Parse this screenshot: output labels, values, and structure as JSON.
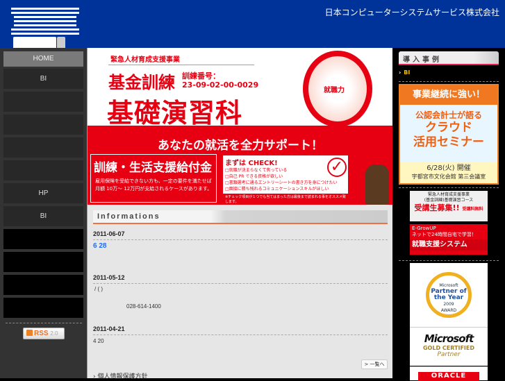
{
  "header": {
    "company": "日本コンピューターシステムサービス株式会社"
  },
  "sidebar": {
    "items": [
      "HOME",
      "BI",
      "",
      "",
      "",
      "",
      "HP",
      "BI",
      "",
      "",
      "",
      ""
    ],
    "rss": {
      "label": "RSS",
      "version": "2.0"
    }
  },
  "banner": {
    "sub": "緊急人材育成支援事業",
    "title1": "基金訓練",
    "number_label": "訓練番号：",
    "number": "23-09-02-00-0029",
    "title2": "基礎演習科",
    "skill": "就職力",
    "slogan": "あなたの就活を全力サポート！",
    "box1_title": "訓練・生活支援給付金",
    "box1_desc1": "雇用保険を受給できない方も、一定の要件を満たせば",
    "box1_desc2": "月額 10万～ 12万円が支給されるケースがあります。",
    "check_title": "まずは CHECK!",
    "check_items": [
      "□就職が決まらなくて焦っている",
      "□自己 PR できる資格が欲しい",
      "□書類選考に通るエントリーシートの書き方を身につけたい",
      "□面接に勝ち残れるコミュニケーションスキルがほしい"
    ],
    "check_note": "※チェック項目が１つでも当てはまった方は最後まで読まれる事をオススメ致します。"
  },
  "info": {
    "heading": "Informations",
    "entries": [
      {
        "date": "2011-06-07",
        "text": "6  28"
      },
      {
        "date": "2011-05-12",
        "text": "/ ( )",
        "phone": "028-614-1400"
      },
      {
        "date": "2011-04-21",
        "text": "4 20"
      }
    ],
    "more": "> 一覧へ",
    "privacy": "› 個人情報保護方針"
  },
  "right": {
    "heading": "導入事例",
    "bi_link": "BI",
    "seminar": {
      "a": "事業継続に強い！",
      "b": "公認会計士が語る",
      "c1": "クラウド",
      "c2": "活用セミナー",
      "date": "6/28(火) 開催",
      "place": "宇都宮市文化会館 第三会議室"
    },
    "ad1": {
      "l1": "緊急人材育成支援事業",
      "l2": "(基金訓練)基礎演習コース",
      "l3": "受講生募集!!",
      "l4": "受講料無料"
    },
    "ad2": {
      "l1": "E-GrowUP",
      "l2": "ネットで24時間自宅で学習！",
      "l3": "就職支援システム"
    },
    "ms1": {
      "a": "Microsoft",
      "b": "Partner of the Year",
      "c": "2009",
      "d": "AWARD"
    },
    "ms2": {
      "a": "Microsoft",
      "b": "GOLD CERTIFIED",
      "c": "Partner"
    },
    "oracle": "ORACLE"
  }
}
